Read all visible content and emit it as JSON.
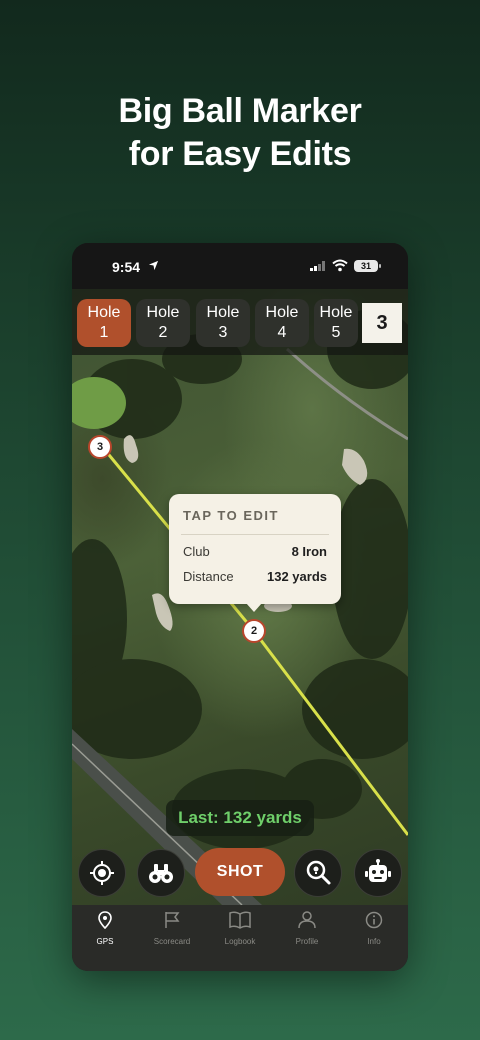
{
  "headline": {
    "line1": "Big Ball Marker",
    "line2": "for Easy Edits"
  },
  "status_bar": {
    "time": "9:54",
    "battery": "31"
  },
  "holes": [
    {
      "label": "Hole",
      "number": "1",
      "active": true
    },
    {
      "label": "Hole",
      "number": "2",
      "active": false
    },
    {
      "label": "Hole",
      "number": "3",
      "active": false
    },
    {
      "label": "Hole",
      "number": "4",
      "active": false
    },
    {
      "label": "Hole",
      "number": "5",
      "active": false
    }
  ],
  "current_hole_number": "3",
  "popup": {
    "title": "TAP TO EDIT",
    "club_label": "Club",
    "club_value": "8 Iron",
    "distance_label": "Distance",
    "distance_value": "132 yards"
  },
  "markers": {
    "marker_a": "3",
    "marker_b": "2"
  },
  "last_shot": "Last: 132 yards",
  "actions": {
    "shot_label": "SHOT"
  },
  "tabs": [
    {
      "label": "GPS",
      "icon": "gps-pin-icon",
      "active": true
    },
    {
      "label": "Scorecard",
      "icon": "flag-icon",
      "active": false
    },
    {
      "label": "Logbook",
      "icon": "book-icon",
      "active": false
    },
    {
      "label": "Profile",
      "icon": "person-icon",
      "active": false
    },
    {
      "label": "Info",
      "icon": "info-icon",
      "active": false
    }
  ],
  "colors": {
    "accent": "#b0502c",
    "shot_line": "#d8e04a",
    "last_text": "#6fcf6a"
  }
}
